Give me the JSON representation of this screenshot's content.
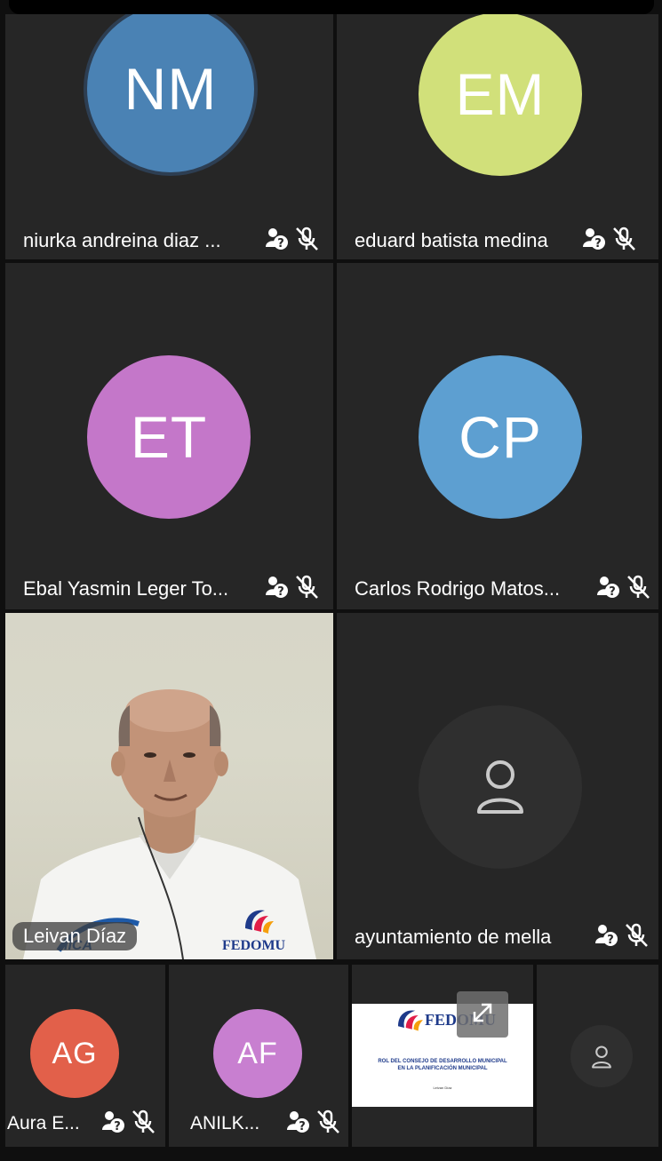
{
  "participants": [
    {
      "initials": "NM",
      "name": "niurka andreina diaz ...",
      "color": "#4a82b4"
    },
    {
      "initials": "EM",
      "name": "eduard batista medina",
      "color": "#d1e07a"
    },
    {
      "initials": "ET",
      "name": "Ebal Yasmin Leger To...",
      "color": "#c477c9"
    },
    {
      "initials": "CP",
      "name": "Carlos Rodrigo Matos...",
      "color": "#5d9fd1"
    }
  ],
  "video_tile": {
    "name": "Leivan Díaz",
    "shirt_logo": "FEDOMU",
    "shirt_logo_left": "IICA"
  },
  "ghost_tile": {
    "name": "ayuntamiento de mella"
  },
  "bottom_row": [
    {
      "initials": "AG",
      "name": "Aura E...",
      "color": "#e2604a"
    },
    {
      "initials": "AF",
      "name": "ANILK...",
      "color": "#c87fd0"
    }
  ],
  "screen_share": {
    "logo": "FEDOMU",
    "title_line1": "ROL DEL CONSEJO DE DESARROLLO MUNICIPAL",
    "title_line2": "EN LA PLANIFICACIÓN MUNICIPAL",
    "presenter": "Leivan Díaz"
  },
  "icons": {
    "unknown_status": "person-question-icon",
    "mic_muted": "mic-off-icon",
    "ghost_person": "person-outline-icon",
    "expand": "expand-icon"
  }
}
